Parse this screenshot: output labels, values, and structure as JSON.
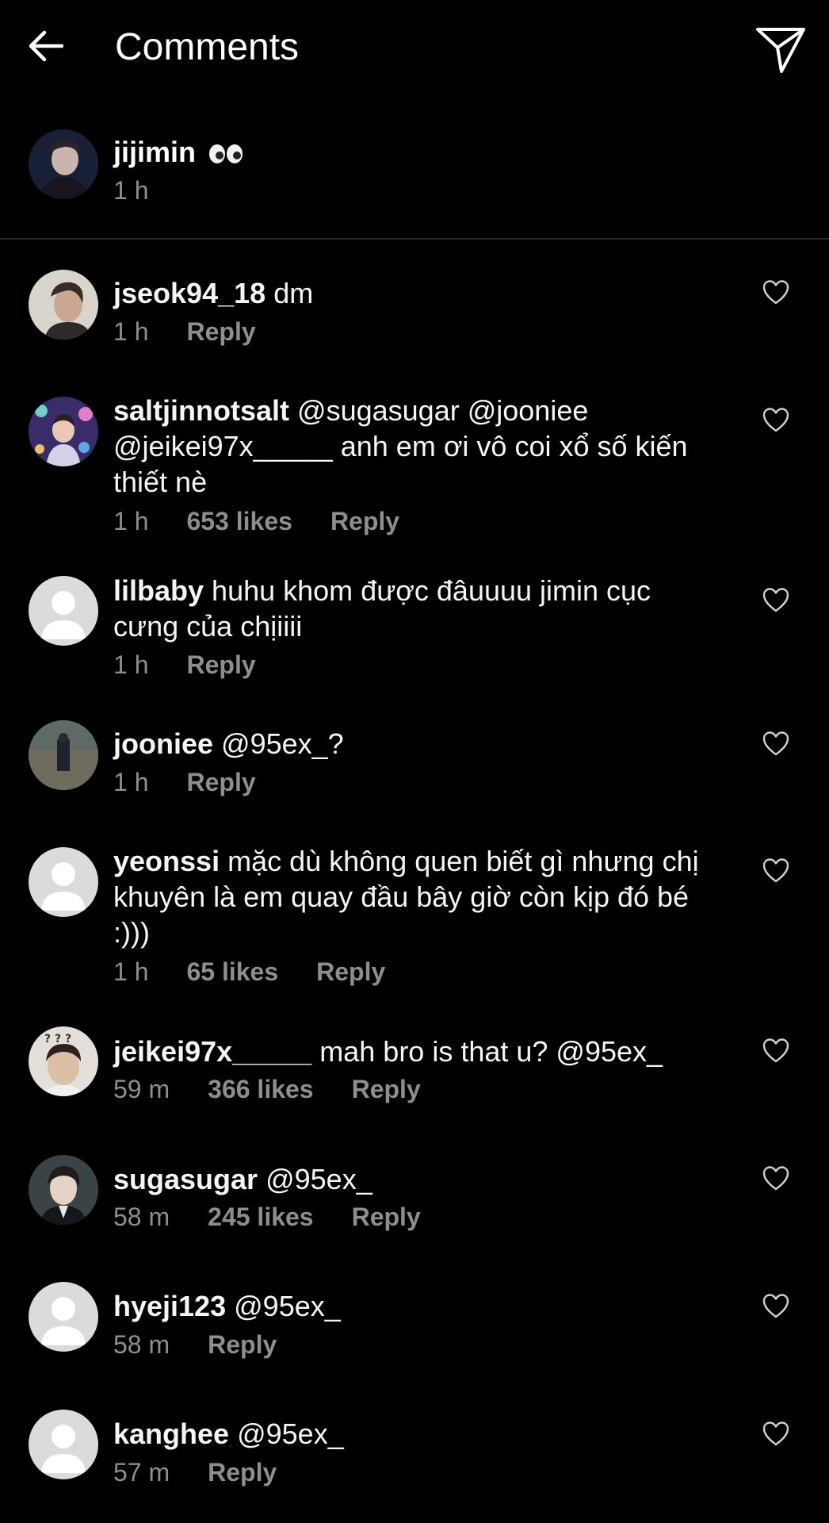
{
  "header": {
    "title": "Comments"
  },
  "caption": {
    "username": "jijimin",
    "time": "1 h"
  },
  "comments": [
    {
      "username": "jseok94_18",
      "text": "dm",
      "time": "1 h",
      "likes": "",
      "reply": "Reply"
    },
    {
      "username": "saltjinnotsalt",
      "text": "@sugasugar @jooniee @jeikei97x_____ anh em ơi vô coi xổ số kiến thiết nè",
      "time": "1 h",
      "likes": "653 likes",
      "reply": "Reply"
    },
    {
      "username": "lilbaby",
      "text": "huhu khom được đâuuuu jimin cục cưng của chịiiii",
      "time": "1 h",
      "likes": "",
      "reply": "Reply"
    },
    {
      "username": "jooniee",
      "text": "@95ex_?",
      "time": "1 h",
      "likes": "",
      "reply": "Reply"
    },
    {
      "username": "yeonssi",
      "text": "mặc dù không quen biết gì nhưng chị khuyên là em quay đầu bây giờ còn kịp đó bé :)))",
      "time": "1 h",
      "likes": "65 likes",
      "reply": "Reply"
    },
    {
      "username": "jeikei97x_____",
      "text": "mah bro is that u? @95ex_",
      "time": "59 m",
      "likes": "366 likes",
      "reply": "Reply"
    },
    {
      "username": "sugasugar",
      "text": "@95ex_",
      "time": "58 m",
      "likes": "245 likes",
      "reply": "Reply"
    },
    {
      "username": "hyeji123",
      "text": "@95ex_",
      "time": "58 m",
      "likes": "",
      "reply": "Reply"
    },
    {
      "username": "kanghee",
      "text": "@95ex_",
      "time": "57 m",
      "likes": "",
      "reply": "Reply"
    }
  ],
  "colors": {
    "background": "#000000",
    "text": "#ffffff",
    "secondary": "#8e8e8e",
    "divider": "#262626"
  }
}
